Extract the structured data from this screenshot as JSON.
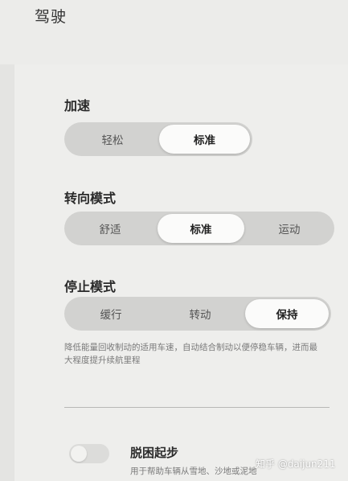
{
  "page": {
    "title": "驾驶"
  },
  "acceleration": {
    "label": "加速",
    "options": [
      "轻松",
      "标准"
    ],
    "selected": "标准"
  },
  "steering": {
    "label": "转向模式",
    "options": [
      "舒适",
      "标准",
      "运动"
    ],
    "selected": "标准"
  },
  "stopping": {
    "label": "停止模式",
    "options": [
      "缓行",
      "转动",
      "保持"
    ],
    "selected": "保持",
    "description": "降低能量回收制动的适用车速，自动结合制动以便停稳车辆，进而最大程度提升续航里程"
  },
  "escape": {
    "title": "脱困起步",
    "description": "用于帮助车辆从雪地、沙地或泥地",
    "enabled": false
  },
  "watermark": "知乎 @daijun211"
}
